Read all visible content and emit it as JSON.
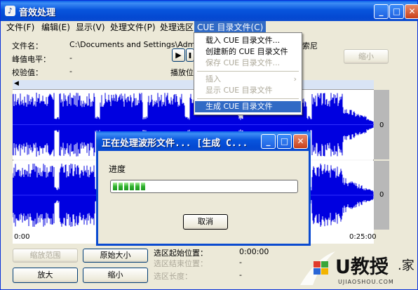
{
  "app": {
    "title": "音效处理"
  },
  "window_buttons": {
    "minimize": "_",
    "maximize": "□",
    "close": "✕"
  },
  "menu": [
    {
      "label": "文件(F)"
    },
    {
      "label": "编辑(E)"
    },
    {
      "label": "显示(V)"
    },
    {
      "label": "处理文件(P)"
    },
    {
      "label": "处理选区"
    },
    {
      "label": "CUE 目录文件(C)"
    }
  ],
  "info": {
    "file_label": "文件名：",
    "file_value": "C:\\Documents and Settings\\Administrator",
    "file_suffix": "索尼",
    "peak_label": "峰值电平：",
    "peak_value": "-",
    "checksum_label": "校验值：",
    "checksum_value": "-",
    "play_label": "播放位",
    "shrink_label": "缩小"
  },
  "cue_menu": {
    "items": [
      {
        "label": "载入 CUE 目录文件...",
        "enabled": true
      },
      {
        "label": "创建新的 CUE 目录文件",
        "enabled": true
      },
      {
        "label": "保存 CUE 目录文件...",
        "enabled": false
      },
      {
        "label": "插入",
        "enabled": false,
        "submenu": true
      },
      {
        "label": "显示 CUE 目录文件",
        "enabled": false
      },
      {
        "label": "生成 CUE 目录文件",
        "enabled": true,
        "highlighted": true
      }
    ]
  },
  "waveform": {
    "channel_label_top": "0",
    "channel_label_bottom": "0",
    "time_start": "0:00",
    "time_end": "0:25:00",
    "wave_color": "#0000e0"
  },
  "bottom": {
    "zoom_range": "缩放范围",
    "original_size": "原始大小",
    "zoom_in": "放大",
    "zoom_out": "缩小",
    "sel_start_label": "选区起始位置：",
    "sel_start_value": "0:00:00",
    "sel_end_label": "选区结束位置：",
    "sel_end_value": "-",
    "sel_len_label": "选区长度：",
    "sel_len_value": "-"
  },
  "dialog": {
    "title": "正在处理波形文件... [生成 C...",
    "progress_label": "进度",
    "progress_fraction": 0.19,
    "cancel": "取消"
  },
  "watermark": {
    "brand": "U教授",
    "suffix": ".家",
    "url": "UJIAOSHOU.COM"
  }
}
